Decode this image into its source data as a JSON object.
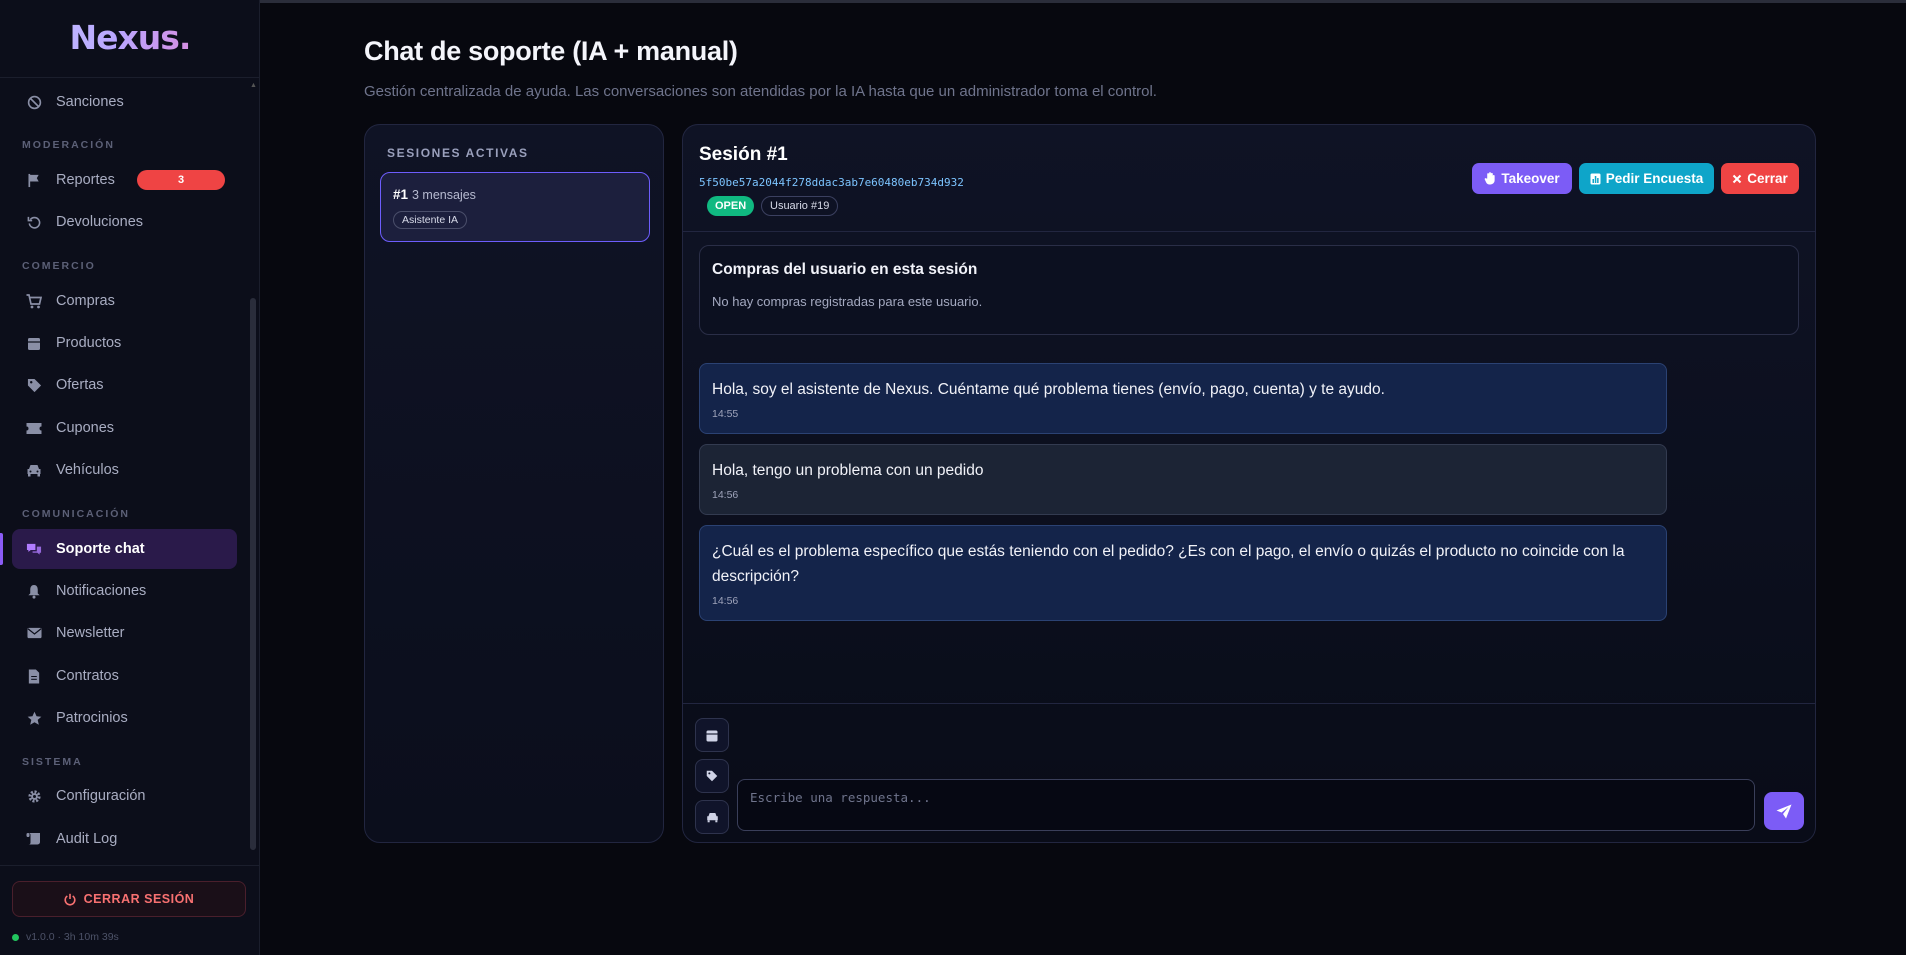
{
  "app": {
    "logo": "Nexus.",
    "version": "v1.0.0 · 3h 10m 39s"
  },
  "sidebar": {
    "items": [
      {
        "label": "Sanciones",
        "icon": "ban-icon"
      },
      {
        "label": "Reportes",
        "icon": "flag-icon",
        "badge": "3"
      },
      {
        "label": "Devoluciones",
        "icon": "undo-icon"
      },
      {
        "label": "Compras",
        "icon": "cart-icon"
      },
      {
        "label": "Productos",
        "icon": "box-icon"
      },
      {
        "label": "Ofertas",
        "icon": "tag-icon"
      },
      {
        "label": "Cupones",
        "icon": "ticket-icon"
      },
      {
        "label": "Vehículos",
        "icon": "car-icon"
      },
      {
        "label": "Soporte chat",
        "icon": "chat-icon",
        "active": true
      },
      {
        "label": "Notificaciones",
        "icon": "bell-icon"
      },
      {
        "label": "Newsletter",
        "icon": "mail-icon"
      },
      {
        "label": "Contratos",
        "icon": "document-icon"
      },
      {
        "label": "Patrocinios",
        "icon": "star-icon"
      },
      {
        "label": "Configuración",
        "icon": "gear-icon"
      },
      {
        "label": "Audit Log",
        "icon": "scroll-icon"
      }
    ],
    "sections": {
      "moderacion": "MODERACIÓN",
      "comercio": "COMERCIO",
      "comunicacion": "COMUNICACIÓN",
      "sistema": "SISTEMA"
    },
    "logout_label": "CERRAR SESIÓN"
  },
  "page": {
    "title": "Chat de soporte (IA + manual)",
    "subtitle": "Gestión centralizada de ayuda. Las conversaciones son atendidas por la IA hasta que un administrador toma el control."
  },
  "sessions": {
    "title": "SESIONES ACTIVAS",
    "list": [
      {
        "number": "#1",
        "messages": "3 mensajes",
        "tag": "Asistente IA",
        "selected": true
      }
    ]
  },
  "chat": {
    "title": "Sesión #1",
    "hash": "5f50be57a2044f278ddac3ab7e60480eb734d932",
    "status": "OPEN",
    "user": "Usuario #19",
    "buttons": {
      "takeover": "Takeover",
      "encuesta": "Pedir Encuesta",
      "cerrar": "Cerrar"
    },
    "purchases": {
      "title": "Compras del usuario en esta sesión",
      "empty": "No hay compras registradas para este usuario."
    },
    "messages": [
      {
        "from": "bot",
        "text": "Hola, soy el asistente de Nexus. Cuéntame qué problema tienes (envío, pago, cuenta) y te ayudo.",
        "time": "14:55"
      },
      {
        "from": "user",
        "text": "Hola, tengo un problema con un pedido",
        "time": "14:56"
      },
      {
        "from": "bot",
        "text": "¿Cuál es el problema específico que estás teniendo con el pedido? ¿Es con el pago, el envío o quizás el producto no coincide con la descripción?",
        "time": "14:56"
      }
    ],
    "composer": {
      "placeholder": "Escribe una respuesta...",
      "value": ""
    }
  },
  "colors": {
    "accent": "#7c5cf6",
    "info": "#0ea5c9",
    "danger": "#ef4444",
    "success": "#10b981"
  }
}
